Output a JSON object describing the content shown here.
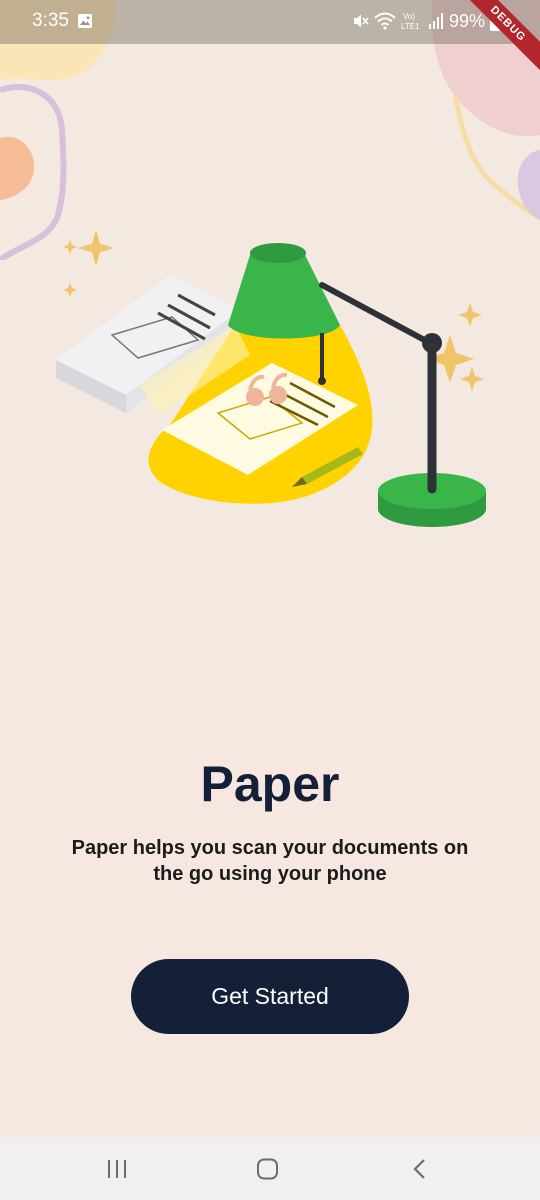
{
  "status_bar": {
    "time": "3:35",
    "battery_percent": "99%",
    "network_label": "LTE1",
    "volte_label": "Vo)",
    "debug_label": "DEBUG"
  },
  "icons": {
    "gallery": "image-icon",
    "mute": "vibrate-mute-icon",
    "wifi": "wifi-icon",
    "signal": "signal-icon",
    "battery": "battery-icon",
    "recents": "recents-icon",
    "home": "home-icon",
    "back": "back-icon"
  },
  "onboarding": {
    "title": "Paper",
    "description": "Paper helps you scan your documents on the go using your phone",
    "cta_label": "Get Started"
  },
  "colors": {
    "background": "#f3e9e0",
    "primary_dark": "#142038",
    "lamp_green": "#3ab54a",
    "light_yellow": "#ffd200",
    "sparkle": "#f2c46a"
  }
}
